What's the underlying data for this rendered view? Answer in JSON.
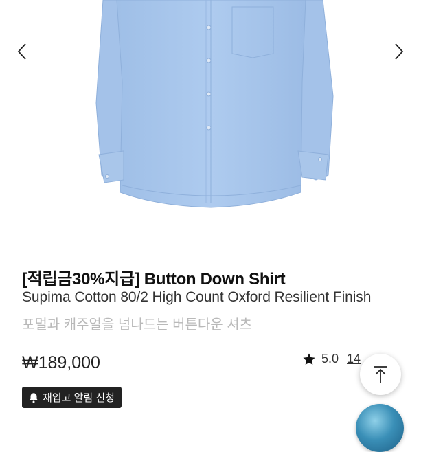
{
  "product": {
    "title": "[적립금30%지급] Button Down Shirt",
    "subtitle": "Supima Cotton 80/2 High Count Oxford Resilient Finish",
    "description": "포멀과 캐주얼을 넘나드는 버튼다운 셔츠",
    "price": "₩189,000",
    "rating": "5.0",
    "review_count": "14"
  },
  "gallery": {
    "prev_icon": "chevron-left-icon",
    "next_icon": "chevron-right-icon",
    "image_name": "light-blue-oxford-shirt"
  },
  "restock": {
    "label": "재입고 알림 신청",
    "icon": "bell-icon"
  },
  "floating": {
    "scroll_top_icon": "arrow-up-icon",
    "chat_icon": "globe-chat-icon"
  },
  "colors": {
    "shirt": "#a9c7ec",
    "shirt_shadow": "#8fb2dd",
    "button_dark": "#222222"
  }
}
